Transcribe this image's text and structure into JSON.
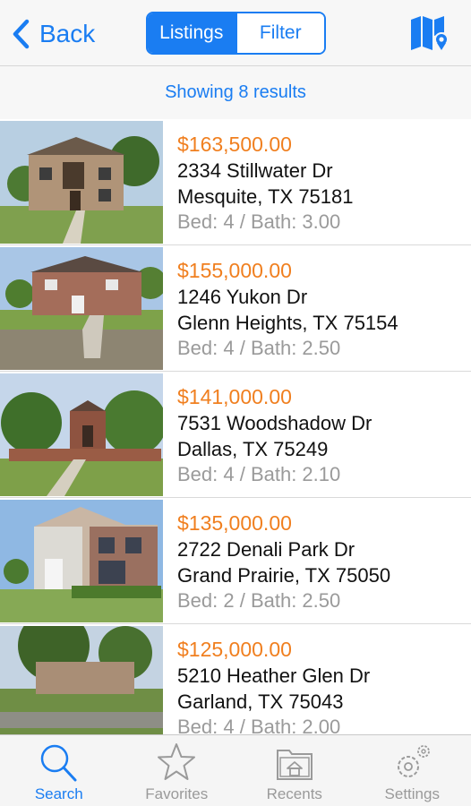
{
  "nav": {
    "back_label": "Back",
    "segments": [
      {
        "label": "Listings",
        "active": true
      },
      {
        "label": "Filter",
        "active": false
      }
    ],
    "map_icon": "map-pin-icon"
  },
  "banner": {
    "text": "Showing 8 results"
  },
  "listings": [
    {
      "price": "$163,500.00",
      "street": "2334 Stillwater Dr",
      "city": "Mesquite, TX 75181",
      "beds": "Bed: 4 / Bath: 3.00"
    },
    {
      "price": "$155,000.00",
      "street": "1246 Yukon Dr",
      "city": "Glenn Heights, TX 75154",
      "beds": "Bed: 4 / Bath: 2.50"
    },
    {
      "price": "$141,000.00",
      "street": "7531 Woodshadow Dr",
      "city": "Dallas, TX 75249",
      "beds": "Bed: 4 / Bath: 2.10"
    },
    {
      "price": "$135,000.00",
      "street": "2722 Denali Park Dr",
      "city": "Grand Prairie, TX 75050",
      "beds": "Bed: 2 / Bath: 2.50"
    },
    {
      "price": "$125,000.00",
      "street": "5210 Heather Glen Dr",
      "city": "Garland, TX 75043",
      "beds": "Bed: 4 / Bath: 2.00"
    }
  ],
  "tabs": [
    {
      "label": "Search",
      "icon": "search-icon",
      "active": true
    },
    {
      "label": "Favorites",
      "icon": "star-icon",
      "active": false
    },
    {
      "label": "Recents",
      "icon": "folder-house-icon",
      "active": false
    },
    {
      "label": "Settings",
      "icon": "gear-icon",
      "active": false
    }
  ],
  "colors": {
    "accent": "#1a7df2",
    "price": "#f07f1f",
    "muted": "#9a9a9a"
  }
}
